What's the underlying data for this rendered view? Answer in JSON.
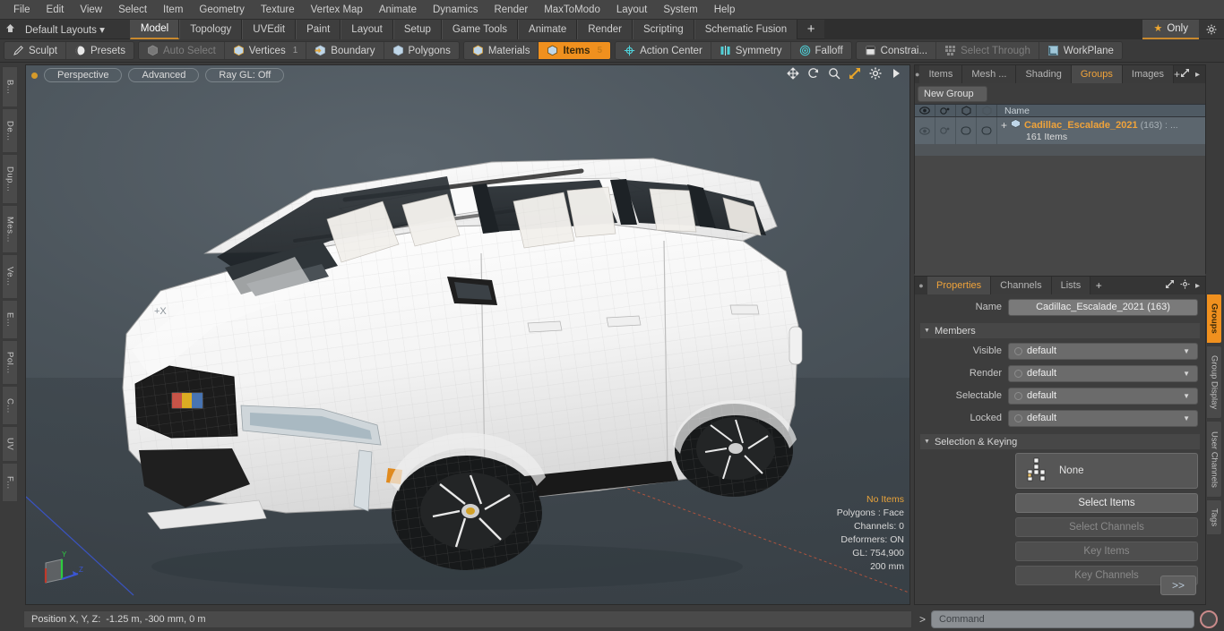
{
  "menu": {
    "items": [
      "File",
      "Edit",
      "View",
      "Select",
      "Item",
      "Geometry",
      "Texture",
      "Vertex Map",
      "Animate",
      "Dynamics",
      "Render",
      "MaxToModo",
      "Layout",
      "System",
      "Help"
    ]
  },
  "layoutbar": {
    "home_icon": "home-icon",
    "layouts_label": "Default Layouts",
    "caret": "▾",
    "tabs": [
      {
        "label": "Model",
        "active": true
      },
      {
        "label": "Topology",
        "active": false
      },
      {
        "label": "UVEdit",
        "active": false
      },
      {
        "label": "Paint",
        "active": false
      },
      {
        "label": "Layout",
        "active": false
      },
      {
        "label": "Setup",
        "active": false
      },
      {
        "label": "Game Tools",
        "active": false
      },
      {
        "label": "Animate",
        "active": false
      },
      {
        "label": "Render",
        "active": false
      },
      {
        "label": "Scripting",
        "active": false
      },
      {
        "label": "Schematic Fusion",
        "active": false
      }
    ],
    "add_label": "+",
    "only_label": "Only",
    "only_star": "★",
    "gear_icon": "gear-icon"
  },
  "modebar": {
    "groups": [
      [
        {
          "label": "Sculpt",
          "icon": "pencil-icon",
          "state": "normal",
          "num": ""
        },
        {
          "label": "Presets",
          "icon": "sphere-icon",
          "state": "normal",
          "num": ""
        }
      ],
      [
        {
          "label": "Auto Select",
          "icon": "cube-grey-icon",
          "state": "dim",
          "num": ""
        },
        {
          "label": "Vertices",
          "icon": "cube-blue-icon",
          "state": "normal",
          "num": "1"
        },
        {
          "label": "Boundary",
          "icon": "cube-arrow-icon",
          "state": "normal",
          "num": ""
        },
        {
          "label": "Polygons",
          "icon": "cube-blue-icon",
          "state": "normal",
          "num": ""
        }
      ],
      [
        {
          "label": "Materials",
          "icon": "cube-blue-icon",
          "state": "normal",
          "num": ""
        },
        {
          "label": "Items",
          "icon": "cube-orange-icon",
          "state": "selected",
          "num": "5"
        }
      ],
      [
        {
          "label": "Action Center",
          "icon": "target-icon",
          "state": "normal",
          "num": ""
        },
        {
          "label": "Symmetry",
          "icon": "symmetry-icon",
          "state": "normal",
          "num": ""
        },
        {
          "label": "Falloff",
          "icon": "falloff-icon",
          "state": "normal",
          "num": ""
        }
      ],
      [
        {
          "label": "Constrai...",
          "icon": "constraint-icon",
          "state": "normal",
          "num": ""
        },
        {
          "label": "Select Through",
          "icon": "select-through-icon",
          "state": "dim",
          "num": ""
        },
        {
          "label": "WorkPlane",
          "icon": "workplane-icon",
          "state": "normal",
          "num": ""
        }
      ]
    ]
  },
  "left_tabs": [
    "B...",
    "De...",
    "Dup...",
    "Mes...",
    "Ve...",
    "E...",
    "Pol...",
    "C...",
    "UV",
    "F..."
  ],
  "viewport": {
    "mode_label": "Perspective",
    "shading_label": "Advanced",
    "raygl_label": "Ray GL: Off",
    "tool_icons": [
      "move-icon",
      "rotate-icon",
      "zoom-icon",
      "fit-icon",
      "gear-icon",
      "play-icon"
    ],
    "stats": {
      "selection": "No Items",
      "polygons": "Polygons : Face",
      "channels": "Channels: 0",
      "deformers": "Deformers: ON",
      "gl": "GL: 754,900",
      "scale": "200 mm"
    },
    "axis_labels": {
      "x": "+X",
      "y": "Y",
      "z": "Z"
    }
  },
  "right_panel": {
    "tabs": [
      {
        "label": "Items",
        "active": false
      },
      {
        "label": "Mesh ...",
        "active": false
      },
      {
        "label": "Shading",
        "active": false
      },
      {
        "label": "Groups",
        "active": true
      },
      {
        "label": "Images",
        "active": false
      }
    ],
    "add_label": "+",
    "expand_icon": "expand-icon",
    "arrow_icon": "chevron-right-icon",
    "new_group_label": "New Group",
    "list_header": {
      "name": "Name",
      "eye_icon": "eye-icon",
      "render_icon": "render-icon",
      "shape_icon": "shape-icon",
      "shape2_icon": "shape-outline-icon"
    },
    "rows": [
      {
        "expander": "+",
        "icon": "group-icon",
        "name": "Cadillac_Escalade_2021",
        "count": "(163) :",
        "ellipsis": "...",
        "subtitle": "161 Items"
      }
    ]
  },
  "properties": {
    "tabs": [
      {
        "label": "Properties",
        "active": true
      },
      {
        "label": "Channels",
        "active": false
      },
      {
        "label": "Lists",
        "active": false
      }
    ],
    "add_label": "+",
    "expand_icon": "expand-icon",
    "gear_icon": "gear-icon",
    "arrow_icon": "chevron-right-icon",
    "name_label": "Name",
    "name_value": "Cadillac_Escalade_2021 (163)",
    "members_section": "Members",
    "fields": [
      {
        "label": "Visible",
        "value": "default"
      },
      {
        "label": "Render",
        "value": "default"
      },
      {
        "label": "Selectable",
        "value": "default"
      },
      {
        "label": "Locked",
        "value": "default"
      }
    ],
    "selection_section": "Selection & Keying",
    "selection_value": "None",
    "selection_icon": "item-grid-icon",
    "buttons": [
      {
        "label": "Select Items",
        "enabled": true
      },
      {
        "label": "Select Channels",
        "enabled": false
      },
      {
        "label": "Key Items",
        "enabled": false
      },
      {
        "label": "Key Channels",
        "enabled": false
      }
    ],
    "go_label": ">>"
  },
  "right_vtabs": [
    {
      "label": "Groups",
      "active": true
    },
    {
      "label": "Group Display",
      "active": false
    },
    {
      "label": "User Channels",
      "active": false
    },
    {
      "label": "Tags",
      "active": false
    }
  ],
  "statusbar": {
    "position_label": "Position X, Y, Z:",
    "position_value": "-1.25 m, -300 mm, 0 m"
  },
  "command": {
    "prompt": ">",
    "placeholder": "Command",
    "record_icon": "record-icon"
  },
  "colors": {
    "accent_orange": "#f0901e",
    "tab_orange": "#c8892e",
    "panel_bg": "#3d3d3d",
    "viewport_bg": "#4b545b",
    "axis_x": "#c0392b",
    "axis_y": "#2ecc40",
    "axis_z": "#3a56d4"
  }
}
